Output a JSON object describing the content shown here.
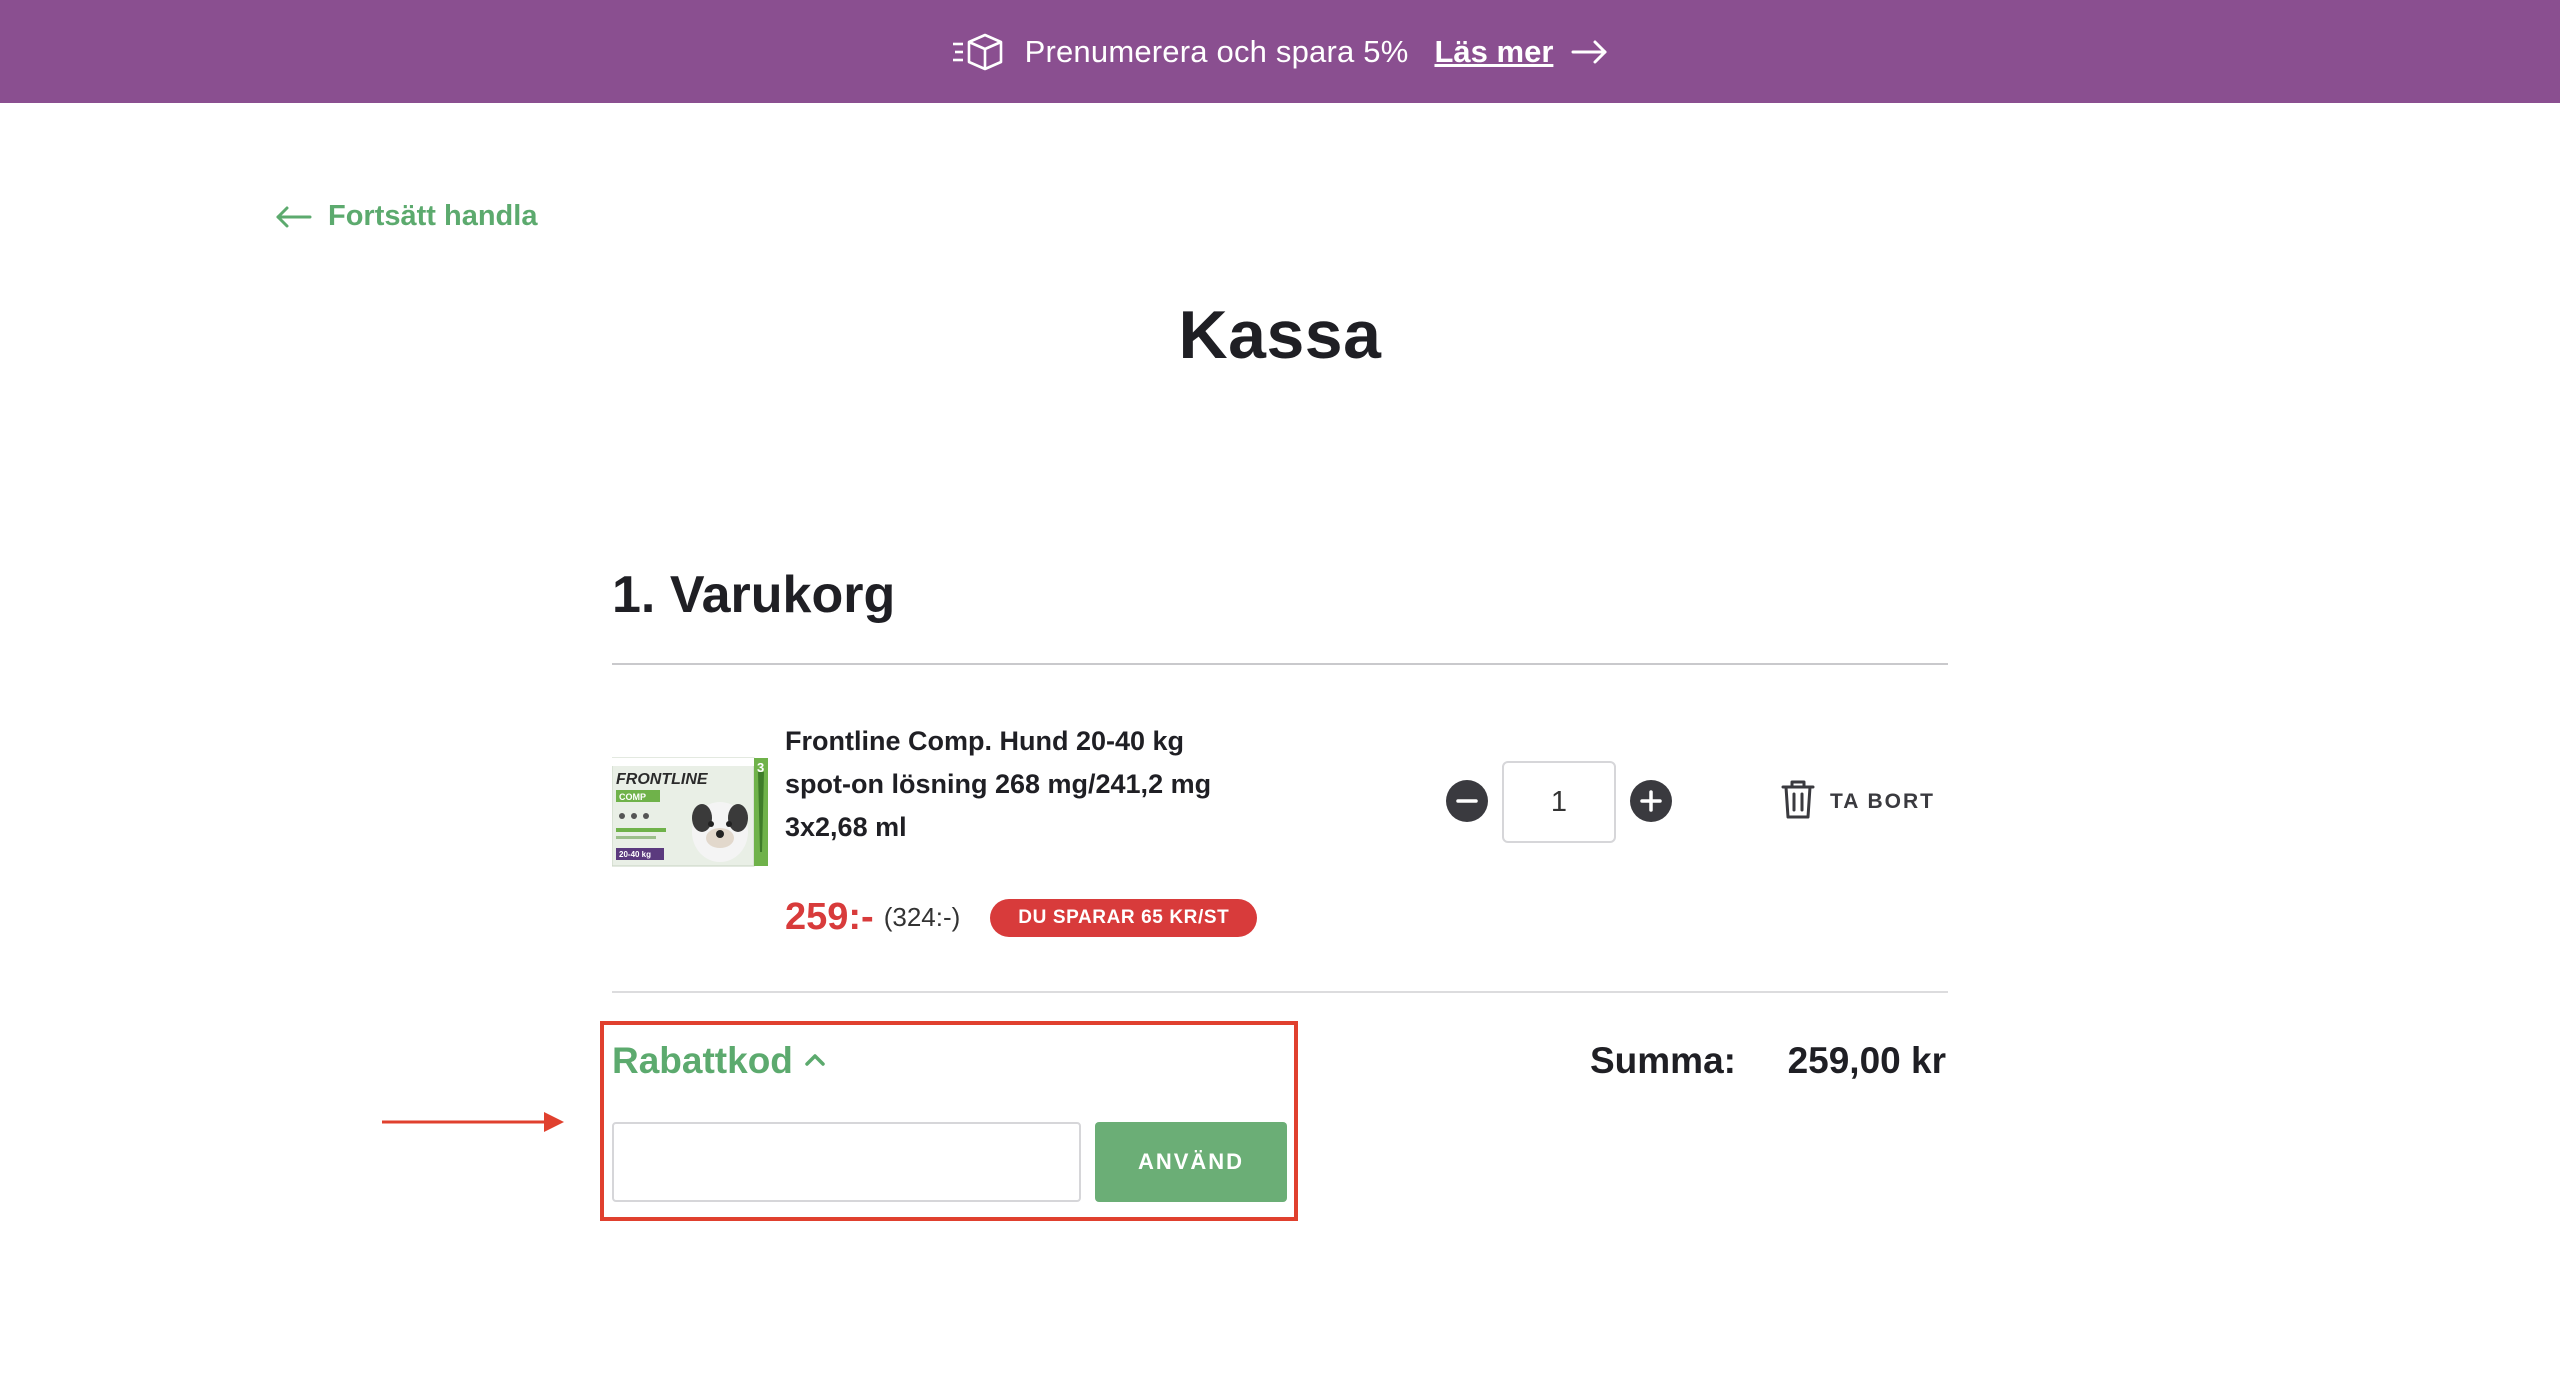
{
  "promo": {
    "text": "Prenumerera och spara 5%",
    "link": "Läs mer",
    "icon": "subscription-box-icon"
  },
  "nav": {
    "back_label": "Fortsätt handla"
  },
  "page": {
    "title": "Kassa"
  },
  "cart": {
    "section_title": "1. Varukorg",
    "item": {
      "image_text": "FRONTLINE COMP",
      "image_weight": "20-40 kg",
      "image_count": "3",
      "name": "Frontline Comp. Hund 20-40 kg spot-on lösning 268 mg/241,2 mg 3x2,68 ml",
      "price": "259:-",
      "old_price": "(324:-)",
      "badge": "DU SPARAR 65 KR/ST",
      "quantity": "1",
      "remove_label": "TA BORT"
    }
  },
  "discount": {
    "label": "Rabattkod",
    "input_value": "",
    "apply_label": "ANVÄND"
  },
  "summary": {
    "label": "Summa:",
    "value": "259,00 kr"
  },
  "colors": {
    "promo_bg": "#8a4f90",
    "accent_green": "#5caa6e",
    "sale_red": "#d83b3b",
    "highlight_red": "#e0402e"
  }
}
